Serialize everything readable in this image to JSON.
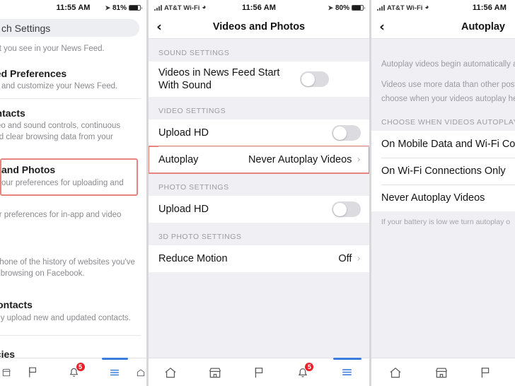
{
  "panels": {
    "left": {
      "status": {
        "carrier": "",
        "time": "11:55 AM",
        "battery": "81%"
      },
      "search_value": "ch Settings",
      "rows": [
        {
          "title": "",
          "sub": "ent you see in your News Feed."
        },
        {
          "title": "eed Preferences",
          "sub": "rol and customize your News Feed."
        },
        {
          "title": "ontacts",
          "sub": "ideo and sound controls, continuous\nand clear browsing data from your"
        },
        {
          "title": "and Photos",
          "sub": "our preferences for uploading and",
          "highlighted": true
        },
        {
          "title": "",
          "sub": "our preferences for in-app and video"
        },
        {
          "title": "r",
          "sub": "r phone of the history of websites you've\nile browsing on Facebook."
        },
        {
          "title": "Contacts",
          "sub": "usly upload new and updated contacts."
        },
        {
          "title": "licies",
          "sub": ""
        }
      ],
      "tabs": [
        {
          "name": "marketplace-icon",
          "active": false
        },
        {
          "name": "flag-icon",
          "active": false
        },
        {
          "name": "notifications-icon",
          "active": false,
          "badge": "5"
        },
        {
          "name": "menu-icon",
          "active": true
        }
      ]
    },
    "middle": {
      "status": {
        "carrier": "AT&T Wi-Fi",
        "time": "11:56 AM",
        "battery": "80%"
      },
      "title": "Videos and Photos",
      "back_icon": "chevron-left-icon",
      "groups": [
        {
          "header": "SOUND SETTINGS",
          "rows": [
            {
              "label": "Videos in News Feed Start With Sound",
              "type": "toggle",
              "on": false
            }
          ]
        },
        {
          "header": "VIDEO SETTINGS",
          "rows": [
            {
              "label": "Upload HD",
              "type": "toggle",
              "on": false
            },
            {
              "label": "Autoplay",
              "type": "value",
              "value": "Never Autoplay Videos",
              "highlighted": true
            }
          ]
        },
        {
          "header": "PHOTO SETTINGS",
          "rows": [
            {
              "label": "Upload HD",
              "type": "toggle",
              "on": false
            }
          ]
        },
        {
          "header": "3D PHOTO SETTINGS",
          "rows": [
            {
              "label": "Reduce Motion",
              "type": "value",
              "value": "Off"
            }
          ]
        }
      ],
      "tabs": [
        {
          "name": "home-icon",
          "active": false
        },
        {
          "name": "marketplace-icon",
          "active": false
        },
        {
          "name": "flag-icon",
          "active": false
        },
        {
          "name": "notifications-icon",
          "active": false,
          "badge": "5"
        },
        {
          "name": "menu-icon",
          "active": true
        }
      ]
    },
    "right": {
      "status": {
        "carrier": "AT&T Wi-Fi",
        "time": "11:56 AM",
        "battery": ""
      },
      "title": "Autoplay",
      "back_icon": "chevron-left-icon",
      "blurb": [
        "Autoplay videos begin automatically as",
        "Videos use more data than other posts",
        "choose when your videos autoplay here"
      ],
      "section_header": "CHOOSE WHEN VIDEOS AUTOPLAY:",
      "options": [
        "On Mobile Data and Wi-Fi Conn",
        "On Wi-Fi Connections Only",
        "Never Autoplay Videos"
      ],
      "footnote": "If your battery is low we turn autoplay o",
      "tabs": [
        {
          "name": "home-icon",
          "active": false
        },
        {
          "name": "marketplace-icon",
          "active": false
        },
        {
          "name": "flag-icon",
          "active": false
        }
      ]
    }
  },
  "colors": {
    "highlight": "#e8847e",
    "accent": "#3b7ddd",
    "badge": "#e8202a",
    "group_bg": "#efeff4"
  }
}
